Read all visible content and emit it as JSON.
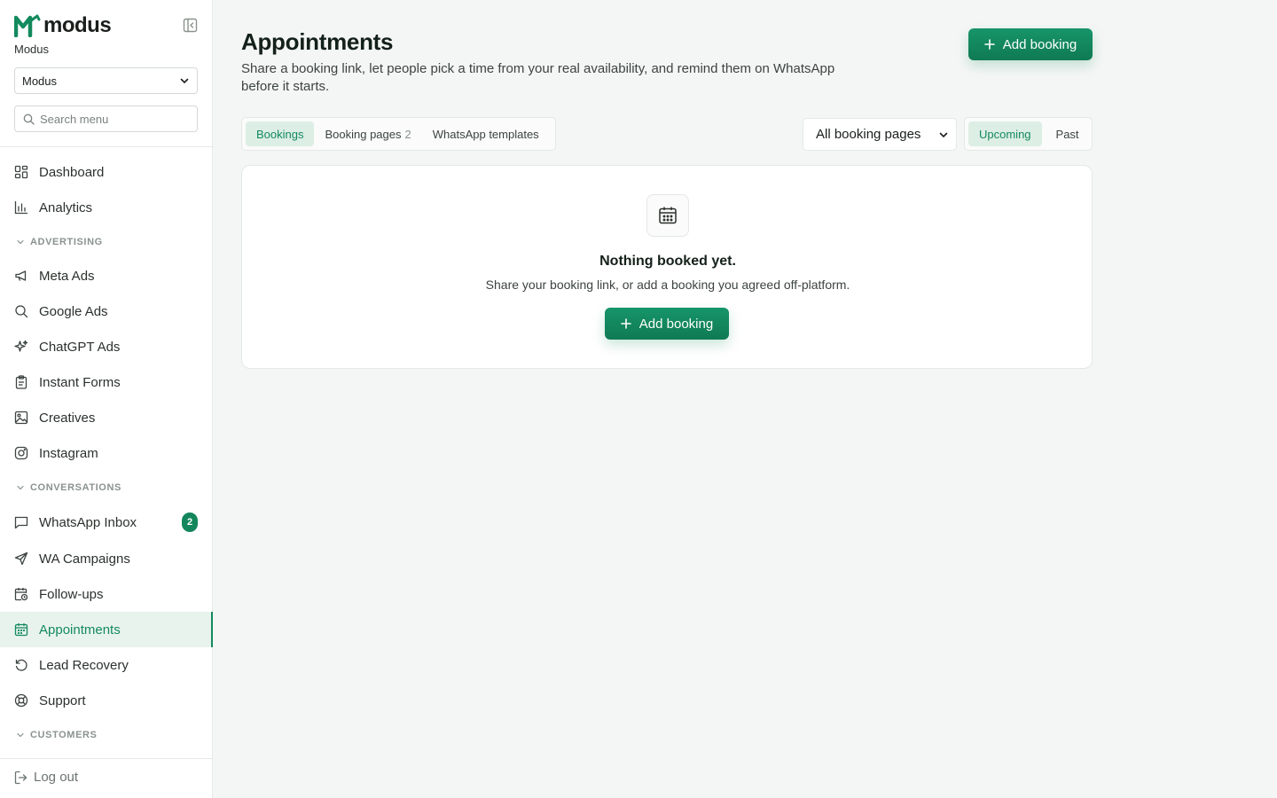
{
  "brand": {
    "word": "modus",
    "org_name": "Modus",
    "color": "#138a5e"
  },
  "org_select": {
    "value": "Modus"
  },
  "search": {
    "placeholder": "Search menu"
  },
  "nav": {
    "dashboard": "Dashboard",
    "analytics": "Analytics",
    "advertising_label": "ADVERTISING",
    "meta_ads": "Meta Ads",
    "google_ads": "Google Ads",
    "chatgpt_ads": "ChatGPT Ads",
    "instant_forms": "Instant Forms",
    "creatives": "Creatives",
    "instagram": "Instagram",
    "conversations_label": "CONVERSATIONS",
    "whatsapp_inbox": "WhatsApp Inbox",
    "whatsapp_inbox_badge": "2",
    "wa_campaigns": "WA Campaigns",
    "follow_ups": "Follow-ups",
    "appointments": "Appointments",
    "lead_recovery": "Lead Recovery",
    "support": "Support",
    "customers_label": "CUSTOMERS",
    "logout": "Log out"
  },
  "page": {
    "title": "Appointments",
    "subtitle": "Share a booking link, let people pick a time from your real availability, and remind them on WhatsApp before it starts.",
    "add_booking_label": "Add booking"
  },
  "tabs": {
    "bookings": "Bookings",
    "booking_pages": "Booking pages",
    "booking_pages_count": "2",
    "whatsapp_templates": "WhatsApp templates"
  },
  "filters": {
    "pages_select_value": "All booking pages",
    "upcoming": "Upcoming",
    "past": "Past"
  },
  "empty_state": {
    "title": "Nothing booked yet.",
    "subtitle": "Share your booking link, or add a booking you agreed off-platform.",
    "button_label": "Add booking"
  }
}
